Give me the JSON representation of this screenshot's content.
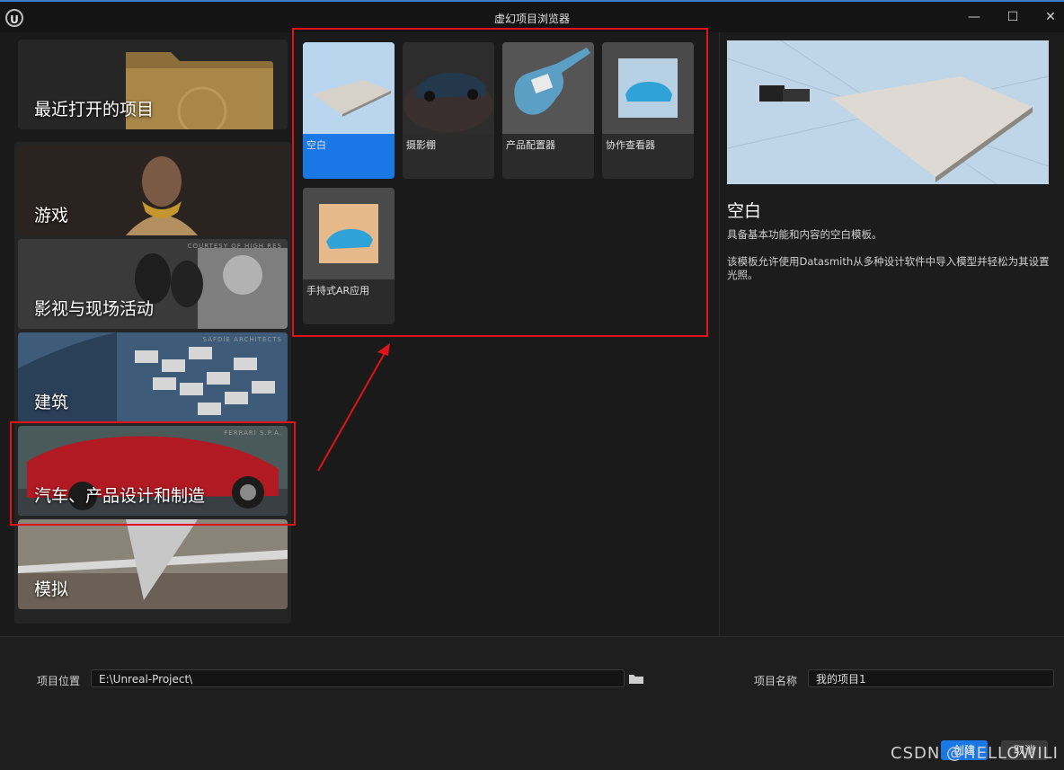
{
  "window": {
    "title": "虚幻项目浏览器",
    "logo": "U",
    "minimize": "—",
    "maximize": "☐",
    "close": "✕"
  },
  "categories": [
    {
      "label": "最近打开的项目"
    },
    {
      "label": "游戏"
    },
    {
      "label": "影视与现场活动",
      "credit": "COURTESY OF HIGH RES"
    },
    {
      "label": "建筑",
      "credit": "SAFDIE ARCHITECTS"
    },
    {
      "label": "汽车、产品设计和制造",
      "credit": "FERRARI S.P.A."
    },
    {
      "label": "模拟"
    }
  ],
  "templates": [
    {
      "name": "空白",
      "selected": true
    },
    {
      "name": "摄影棚"
    },
    {
      "name": "产品配置器"
    },
    {
      "name": "协作查看器"
    },
    {
      "name": "手持式AR应用"
    }
  ],
  "details": {
    "title": "空白",
    "line1": "具备基本功能和内容的空白模板。",
    "line2": "该模板允许使用Datasmith从多种设计软件中导入模型并轻松为其设置光照。"
  },
  "footer": {
    "location_label": "项目位置",
    "location_value": "E:\\Unreal-Project\\",
    "name_label": "项目名称",
    "name_value": "我的项目1",
    "create_label": "创建",
    "cancel_label": "取消",
    "watermark": "CSDN @HELLOWILI"
  },
  "colors": {
    "accent": "#1978e5",
    "highlight_box": "#e0121a",
    "background": "#1a1a1a"
  }
}
